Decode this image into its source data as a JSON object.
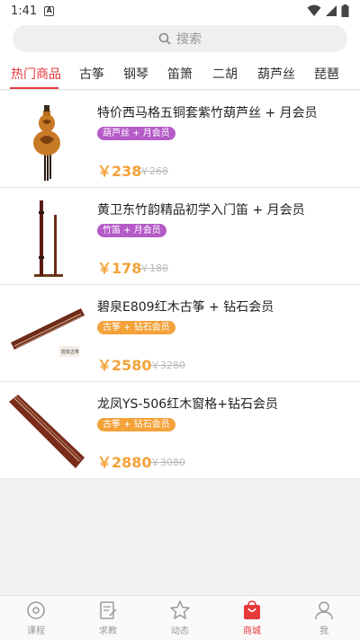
{
  "status": {
    "time": "1:41",
    "badge": "A"
  },
  "search": {
    "placeholder": "搜索"
  },
  "tabs": [
    "热门商品",
    "古筝",
    "钢琴",
    "笛箫",
    "二胡",
    "葫芦丝",
    "琵琶"
  ],
  "products": [
    {
      "title": "特价西马格五铜套紫竹葫芦丝 + 月会员",
      "tag": "葫芦丝 + 月会员",
      "tag_color": "#b45bc7",
      "price": "￥238",
      "old_price": "￥268",
      "icon": "hulusi-image"
    },
    {
      "title": "黄卫东竹韵精品初学入门笛 + 月会员",
      "tag": "竹笛 + 月会员",
      "tag_color": "#b45bc7",
      "price": "￥178",
      "old_price": "￥188",
      "icon": "dizi-image"
    },
    {
      "title": "碧泉E809红木古筝 + 钻石会员",
      "tag": "古筝 + 钻石会员",
      "tag_color": "#f3a23a",
      "price": "￥2580",
      "old_price": "￥3280",
      "icon": "guzheng-image"
    },
    {
      "title": "龙凤YS-506红木窗格+钻石会员",
      "tag": "古筝 + 钻石会员",
      "tag_color": "#f3a23a",
      "price": "￥2880",
      "old_price": "￥3080",
      "icon": "guzheng-image"
    }
  ],
  "nav": [
    "课程",
    "求教",
    "动态",
    "商城",
    "我"
  ],
  "colors": {
    "accent": "#e5383b",
    "price": "#f3a23a"
  }
}
